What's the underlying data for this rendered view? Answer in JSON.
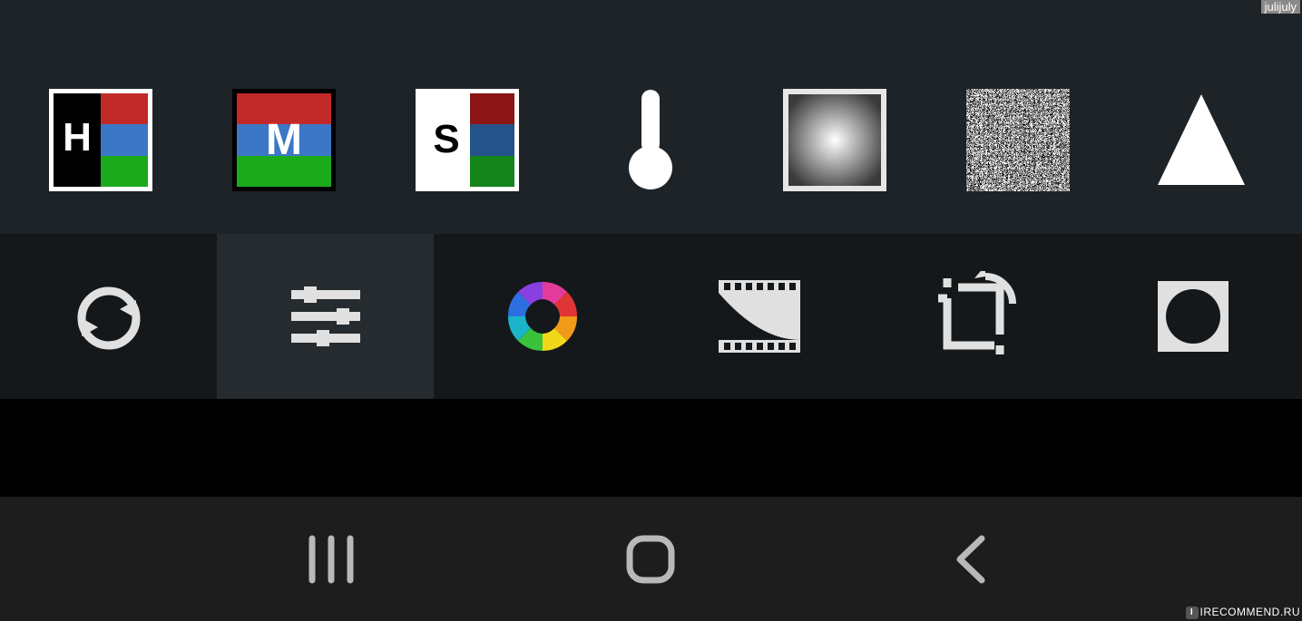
{
  "watermark_user": "julijuly",
  "watermark_site": "IRECOMMEND.RU",
  "watermark_badge": "I",
  "adjustments": {
    "h_label": "H",
    "m_label": "M",
    "s_label": "S",
    "items": [
      {
        "name": "highlights-icon"
      },
      {
        "name": "midtones-icon"
      },
      {
        "name": "shadows-icon"
      },
      {
        "name": "temperature-icon"
      },
      {
        "name": "vignette-icon"
      },
      {
        "name": "noise-icon"
      },
      {
        "name": "sharpen-icon"
      }
    ]
  },
  "categories": [
    {
      "name": "reset-icon",
      "active": false
    },
    {
      "name": "sliders-icon",
      "active": true
    },
    {
      "name": "color-icon",
      "active": false
    },
    {
      "name": "film-icon",
      "active": false
    },
    {
      "name": "crop-icon",
      "active": false
    },
    {
      "name": "shape-icon",
      "active": false
    }
  ],
  "nav": [
    {
      "name": "recents-icon"
    },
    {
      "name": "home-icon"
    },
    {
      "name": "back-icon"
    }
  ]
}
